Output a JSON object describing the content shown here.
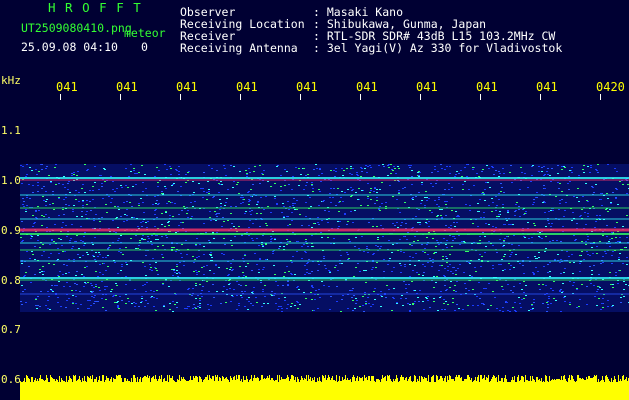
{
  "title": "H R O F F T",
  "filename": "UT2509080410.png",
  "subtitle": "meteor",
  "datetime": "25.09.08 04:10",
  "counter": "0",
  "info": [
    {
      "label": "Observer",
      "value": ": Masaki Kano"
    },
    {
      "label": "Receiving Location",
      "value": ": Shibukawa, Gunma, Japan"
    },
    {
      "label": "Receiver",
      "value": ": RTL-SDR SDR# 43dB L15 103.2MHz CW"
    },
    {
      "label": "Receiving Antenna",
      "value": ": 3el Yagi(V) Az 330 for Vladivostok"
    }
  ],
  "yunit": "kHz",
  "time_ticks": [
    "041",
    "041",
    "041",
    "041",
    "041",
    "041",
    "041",
    "041",
    "041",
    "0420"
  ],
  "freq_ticks": [
    "1.1",
    "1.0",
    "0.9",
    "0.8",
    "0.7",
    "0.6"
  ],
  "colors": {
    "background": "#000033",
    "title": "#33ff33",
    "text": "#ffffff",
    "labels": "#ffff00",
    "signal": "#ff3366",
    "noise_blue": "#1a3cff",
    "noise_cyan": "#33ffff",
    "noise_green": "#33ff66",
    "level_bar": "#ffff00"
  }
}
